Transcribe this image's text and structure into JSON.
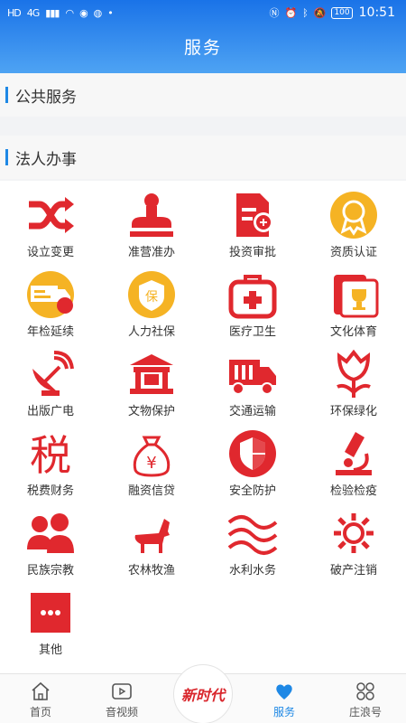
{
  "status_bar": {
    "left": "HD",
    "network": "4G",
    "time": "10:51",
    "battery": "100"
  },
  "header": {
    "title": "服务"
  },
  "sections": {
    "public": "公共服务",
    "legal": "法人办事"
  },
  "items": [
    {
      "label": "设立变更",
      "icon": "shuffle-icon"
    },
    {
      "label": "准营准办",
      "icon": "seal-stamp-icon"
    },
    {
      "label": "投资审批",
      "icon": "document-approval-icon"
    },
    {
      "label": "资质认证",
      "icon": "certificate-badge-icon"
    },
    {
      "label": "年检延续",
      "icon": "inspection-truck-icon"
    },
    {
      "label": "人力社保",
      "icon": "insurance-shield-icon"
    },
    {
      "label": "医疗卫生",
      "icon": "medical-kit-icon"
    },
    {
      "label": "文化体育",
      "icon": "trophy-icon"
    },
    {
      "label": "出版广电",
      "icon": "satellite-dish-icon"
    },
    {
      "label": "文物保护",
      "icon": "heritage-building-icon"
    },
    {
      "label": "交通运输",
      "icon": "truck-icon"
    },
    {
      "label": "环保绿化",
      "icon": "tulip-icon"
    },
    {
      "label": "税费财务",
      "icon": "tax-character-icon"
    },
    {
      "label": "融资信贷",
      "icon": "money-bag-icon"
    },
    {
      "label": "安全防护",
      "icon": "safety-shield-icon"
    },
    {
      "label": "检验检疫",
      "icon": "microscope-icon"
    },
    {
      "label": "民族宗教",
      "icon": "people-group-icon"
    },
    {
      "label": "农林牧渔",
      "icon": "horse-icon"
    },
    {
      "label": "水利水务",
      "icon": "water-waves-icon"
    },
    {
      "label": "破产注销",
      "icon": "gear-icon"
    },
    {
      "label": "其他",
      "icon": "more-dots-icon"
    }
  ],
  "tabbar": {
    "home": "首页",
    "video": "音视频",
    "logo_text": "新时代",
    "service": "服务",
    "zhuanglang": "庄浪号"
  },
  "colors": {
    "accent": "#1e88e5",
    "icon_red": "#e0282e",
    "icon_gold": "#f5b324"
  }
}
